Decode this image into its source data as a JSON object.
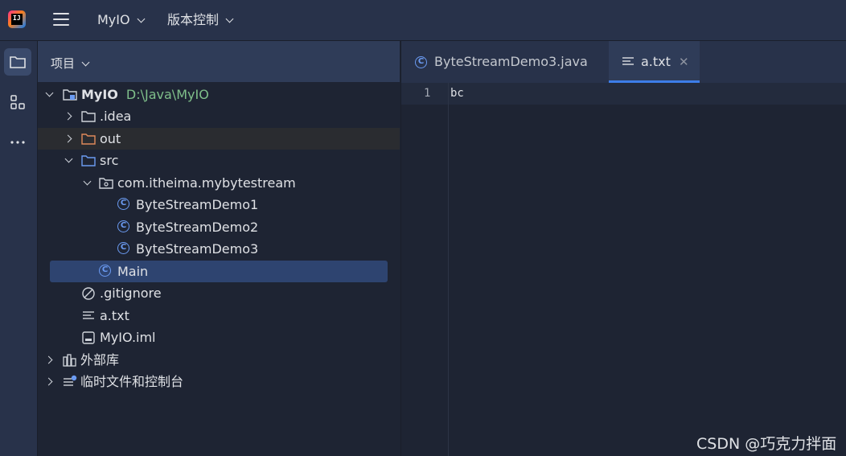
{
  "titlebar": {
    "project": "MyIO",
    "vcs": "版本控制"
  },
  "panel": {
    "title": "项目"
  },
  "tree": {
    "root": {
      "name": "MyIO",
      "path": "D:\\Java\\MyIO"
    },
    "idea": ".idea",
    "out": "out",
    "src": "src",
    "pkg": "com.itheima.mybytestream",
    "classes": [
      "ByteStreamDemo1",
      "ByteStreamDemo2",
      "ByteStreamDemo3"
    ],
    "main": "Main",
    "gitignore": ".gitignore",
    "atxt": "a.txt",
    "iml": "MyIO.iml",
    "external": "外部库",
    "scratches": "临时文件和控制台"
  },
  "editor": {
    "tabs": [
      "ByteStreamDemo3.java",
      "a.txt"
    ],
    "active_tab": 1,
    "lines": [
      {
        "num": "1",
        "text": "bc"
      }
    ]
  },
  "watermark": "CSDN @巧克力拌面",
  "colors": {
    "accent": "#3d7de8",
    "class_icon": "#6b9bf2",
    "path": "#7fbf8a",
    "folder_out": "#e08a5a",
    "folder_src": "#6b9bf2"
  }
}
